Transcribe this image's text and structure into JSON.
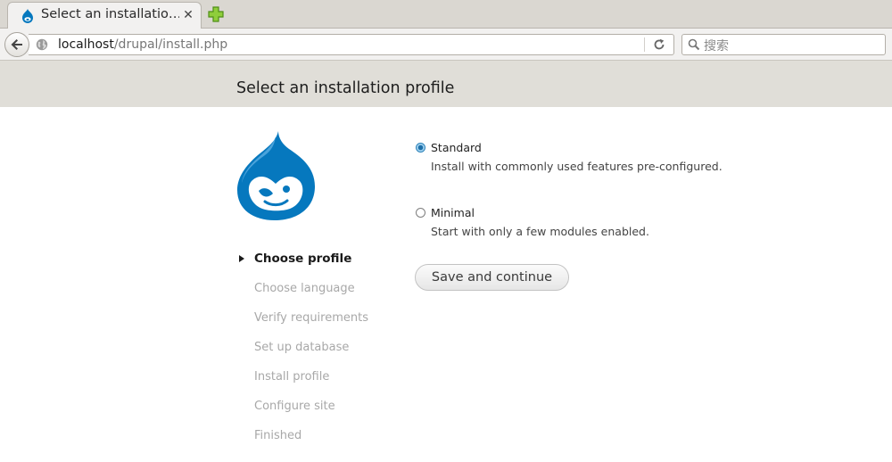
{
  "browser": {
    "tab_title": "Select an installatio…",
    "tab_close": "✕",
    "url_host": "localhost",
    "url_path": "/drupal/install.php",
    "search_placeholder": "搜索"
  },
  "page": {
    "title": "Select an installation profile"
  },
  "steps": [
    {
      "label": "Choose profile",
      "active": true
    },
    {
      "label": "Choose language",
      "active": false
    },
    {
      "label": "Verify requirements",
      "active": false
    },
    {
      "label": "Set up database",
      "active": false
    },
    {
      "label": "Install profile",
      "active": false
    },
    {
      "label": "Configure site",
      "active": false
    },
    {
      "label": "Finished",
      "active": false
    }
  ],
  "profiles": [
    {
      "label": "Standard",
      "description": "Install with commonly used features pre-configured.",
      "selected": true
    },
    {
      "label": "Minimal",
      "description": "Start with only a few modules enabled.",
      "selected": false
    }
  ],
  "form": {
    "submit_label": "Save and continue"
  },
  "colors": {
    "drupal_blue": "#0678be",
    "header_bg": "#e0ded8",
    "radio_accent": "#2a81b8"
  },
  "icons": {
    "logo": "drupal-drop-icon",
    "back": "back-arrow-icon",
    "site": "globe-icon",
    "reload": "reload-icon",
    "search": "search-icon",
    "new_tab": "plus-icon"
  }
}
